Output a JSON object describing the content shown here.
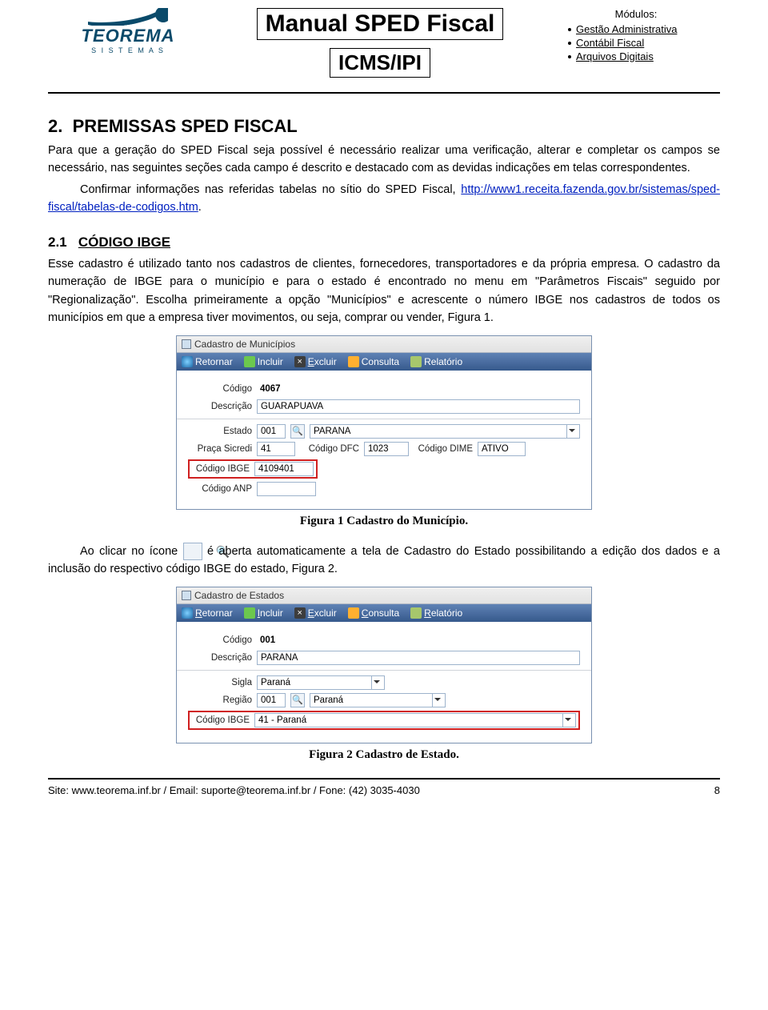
{
  "header": {
    "brand": "TEOREMA",
    "brand_tag": "S I S T E M A S",
    "title1": "Manual SPED Fiscal",
    "title2": "ICMS/IPI",
    "modules_title": "Módulos:",
    "modules": [
      "Gestão Administrativa",
      "Contábil Fiscal",
      "Arquivos Digitais"
    ]
  },
  "section2": {
    "num": "2.",
    "title": "PREMISSAS SPED FISCAL",
    "p1": "Para que a geração do SPED Fiscal seja possível é necessário realizar uma verificação, alterar e completar os campos se necessário, nas seguintes seções cada campo é descrito e destacado com as devidas indicações em telas correspondentes.",
    "p2_prefix": "Confirmar informações nas referidas tabelas no sítio do SPED Fiscal, ",
    "link": "http://www1.receita.fazenda.gov.br/sistemas/sped-fiscal/tabelas-de-codigos.htm",
    "p2_suffix": "."
  },
  "section21": {
    "num": "2.1",
    "title": "CÓDIGO IBGE",
    "p": "Esse cadastro é utilizado tanto nos cadastros de clientes, fornecedores, transportadores e da própria empresa. O cadastro da numeração de IBGE para o município e para o estado é encontrado no menu em \"Parâmetros Fiscais\" seguido por \"Regionalização\". Escolha primeiramente a opção \"Municípios\" e acrescente o número IBGE nos cadastros de todos os municípios em que a empresa tiver movimentos, ou seja, comprar ou vender, Figura 1."
  },
  "app1": {
    "title": "Cadastro de Municípios",
    "toolbar": {
      "retornar": "Retornar",
      "incluir": "Incluir",
      "excluir": "Excluir",
      "consulta": "Consulta",
      "relatorio": "Relatório"
    },
    "labels": {
      "codigo": "Código",
      "descricao": "Descrição",
      "estado": "Estado",
      "praca": "Praça Sicredi",
      "cod_dfc": "Código DFC",
      "cod_dime": "Código DIME",
      "cod_ibge": "Código IBGE",
      "cod_anp": "Código ANP"
    },
    "values": {
      "codigo": "4067",
      "descricao": "GUARAPUAVA",
      "estado_code": "001",
      "estado_nome": "PARANA",
      "praca": "41",
      "cod_dfc": "1023",
      "cod_dime": "ATIVO",
      "cod_ibge": "4109401",
      "cod_anp": ""
    }
  },
  "caption1": "Figura 1 Cadastro do Município.",
  "p_icon_before": "Ao clicar no ícone ",
  "p_icon_after": " é aberta automaticamente a tela de Cadastro do Estado possibilitando a edição dos dados e a inclusão do respectivo código IBGE do estado, Figura 2.",
  "app2": {
    "title": "Cadastro de Estados",
    "toolbar": {
      "retornar": "Retornar",
      "incluir": "Incluir",
      "excluir": "Excluir",
      "consulta": "Consulta",
      "relatorio": "Relatório"
    },
    "labels": {
      "codigo": "Código",
      "descricao": "Descrição",
      "sigla": "Sigla",
      "regiao": "Região",
      "cod_ibge": "Código IBGE"
    },
    "values": {
      "codigo": "001",
      "descricao": "PARANA",
      "sigla": "Paraná",
      "regiao_code": "001",
      "regiao_nome": "Paraná",
      "cod_ibge": "41 - Paraná"
    }
  },
  "caption2": "Figura 2 Cadastro de Estado.",
  "footer": {
    "text": "Site: www.teorema.inf.br / Email: suporte@teorema.inf.br / Fone: (42) 3035-4030",
    "page": "8"
  },
  "icons": {
    "lookup": "🔍"
  }
}
